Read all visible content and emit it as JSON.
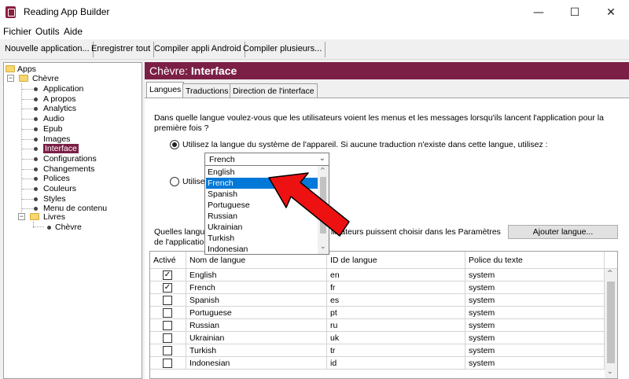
{
  "window": {
    "title": "Reading App Builder"
  },
  "menu": [
    "Fichier",
    "Outils",
    "Aide"
  ],
  "toolbar": {
    "new_app": "Nouvelle application...",
    "save_all": "Enregistrer tout",
    "build_android": "Compiler appli Android",
    "build_multiple": "Compiler plusieurs..."
  },
  "tree": {
    "root": "Apps",
    "app": "Chèvre",
    "items": [
      "Application",
      "A propos",
      "Analytics",
      "Audio",
      "Epub",
      "Images",
      "Interface",
      "Configurations",
      "Changements",
      "Polices",
      "Couleurs",
      "Styles",
      "Menu de contenu"
    ],
    "selected_index": 6,
    "books_folder": "Livres",
    "book": "Chèvre"
  },
  "header": {
    "prefix": "Chèvre: ",
    "title": "Interface"
  },
  "tabs": [
    "Langues",
    "Traductions",
    "Direction de l'interface"
  ],
  "question": {
    "line1": "Dans quelle langue voulez-vous que les utilisateurs voient les menus et les messages lorsqu'ils lancent l'application pour la",
    "line2": "première fois ?"
  },
  "radio1": {
    "label": "Utilisez la langue du système de l'appareil. Si aucune traduction n'existe dans cette langue, utilisez :",
    "checked": true
  },
  "radio2": {
    "label": "Utilise",
    "checked": false
  },
  "select": {
    "value": "French"
  },
  "dropdown": {
    "options": [
      "English",
      "French",
      "Spanish",
      "Portuguese",
      "Russian",
      "Ukrainian",
      "Turkish",
      "Indonesian"
    ],
    "highlighted_index": 1
  },
  "choose_text": {
    "line1_left": "Quelles langue",
    "line1_right": "ilisateurs puissent choisir dans les Paramètres",
    "line2_left": "de l'applicatio"
  },
  "add_language_button": "Ajouter langue...",
  "grid": {
    "headers": [
      "Activé",
      "Nom de langue",
      "ID de langue",
      "Police du texte"
    ],
    "rows": [
      {
        "active": true,
        "name": "English",
        "id": "en",
        "font": "system"
      },
      {
        "active": true,
        "name": "French",
        "id": "fr",
        "font": "system"
      },
      {
        "active": false,
        "name": "Spanish",
        "id": "es",
        "font": "system"
      },
      {
        "active": false,
        "name": "Portuguese",
        "id": "pt",
        "font": "system"
      },
      {
        "active": false,
        "name": "Russian",
        "id": "ru",
        "font": "system"
      },
      {
        "active": false,
        "name": "Ukrainian",
        "id": "uk",
        "font": "system"
      },
      {
        "active": false,
        "name": "Turkish",
        "id": "tr",
        "font": "system"
      },
      {
        "active": false,
        "name": "Indonesian",
        "id": "id",
        "font": "system"
      }
    ]
  },
  "colors": {
    "accent": "#7b1f46",
    "highlight": "#0078d7",
    "arrow": "#ee1111"
  }
}
